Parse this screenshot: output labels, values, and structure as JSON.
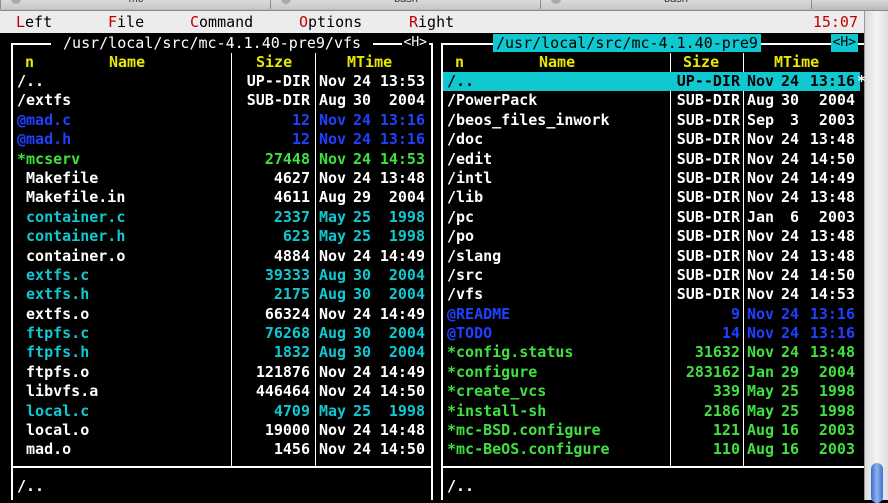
{
  "window_tabs": [
    {
      "title": "mc"
    },
    {
      "title": "bash"
    },
    {
      "title": "bash"
    }
  ],
  "menubar": {
    "items": [
      {
        "hotkey": "L",
        "rest": "eft"
      },
      {
        "hotkey": "F",
        "rest": "ile"
      },
      {
        "hotkey": "C",
        "rest": "ommand"
      },
      {
        "hotkey": "O",
        "rest": "ptions"
      },
      {
        "hotkey": "R",
        "rest": "ight"
      }
    ],
    "clock": "15:07"
  },
  "colors": {
    "dir": "#ffffff",
    "plain": "#ffffff",
    "source": "#10c8d0",
    "exec": "#40e040",
    "link": "#2040ff",
    "header": "#e8e800",
    "selection": "#10c8d0"
  },
  "left_panel": {
    "path": " /usr/local/src/mc-4.1.40-pre9/vfs ",
    "hint": "<H>",
    "columns": {
      "n": "n",
      "name": "Name",
      "size": "Size",
      "mtime": "MTime"
    },
    "status": "/..",
    "rows": [
      {
        "name": "/..",
        "size": "UP--DIR",
        "month": "Nov",
        "day": "24",
        "time": "13:53",
        "kind": "dir"
      },
      {
        "name": "/extfs",
        "size": "SUB-DIR",
        "month": "Aug",
        "day": "30",
        "time": "2004",
        "kind": "dir"
      },
      {
        "name": "@mad.c",
        "size": "12",
        "month": "Nov",
        "day": "24",
        "time": "13:16",
        "kind": "link"
      },
      {
        "name": "@mad.h",
        "size": "12",
        "month": "Nov",
        "day": "24",
        "time": "13:16",
        "kind": "link"
      },
      {
        "name": "*mcserv",
        "size": "27448",
        "month": "Nov",
        "day": "24",
        "time": "14:53",
        "kind": "exec"
      },
      {
        "name": " Makefile",
        "size": "4627",
        "month": "Nov",
        "day": "24",
        "time": "13:48",
        "kind": "plain"
      },
      {
        "name": " Makefile.in",
        "size": "4611",
        "month": "Aug",
        "day": "29",
        "time": "2004",
        "kind": "plain"
      },
      {
        "name": " container.c",
        "size": "2337",
        "month": "May",
        "day": "25",
        "time": "1998",
        "kind": "source"
      },
      {
        "name": " container.h",
        "size": "623",
        "month": "May",
        "day": "25",
        "time": "1998",
        "kind": "source"
      },
      {
        "name": " container.o",
        "size": "4884",
        "month": "Nov",
        "day": "24",
        "time": "14:49",
        "kind": "plain"
      },
      {
        "name": " extfs.c",
        "size": "39333",
        "month": "Aug",
        "day": "30",
        "time": "2004",
        "kind": "source"
      },
      {
        "name": " extfs.h",
        "size": "2175",
        "month": "Aug",
        "day": "30",
        "time": "2004",
        "kind": "source"
      },
      {
        "name": " extfs.o",
        "size": "66324",
        "month": "Nov",
        "day": "24",
        "time": "14:49",
        "kind": "plain"
      },
      {
        "name": " ftpfs.c",
        "size": "76268",
        "month": "Aug",
        "day": "30",
        "time": "2004",
        "kind": "source"
      },
      {
        "name": " ftpfs.h",
        "size": "1832",
        "month": "Aug",
        "day": "30",
        "time": "2004",
        "kind": "source"
      },
      {
        "name": " ftpfs.o",
        "size": "121876",
        "month": "Nov",
        "day": "24",
        "time": "14:49",
        "kind": "plain"
      },
      {
        "name": " libvfs.a",
        "size": "446464",
        "month": "Nov",
        "day": "24",
        "time": "14:50",
        "kind": "plain"
      },
      {
        "name": " local.c",
        "size": "4709",
        "month": "May",
        "day": "25",
        "time": "1998",
        "kind": "source"
      },
      {
        "name": " local.o",
        "size": "19000",
        "month": "Nov",
        "day": "24",
        "time": "14:48",
        "kind": "plain"
      },
      {
        "name": " mad.o",
        "size": "1456",
        "month": "Nov",
        "day": "24",
        "time": "14:50",
        "kind": "plain"
      }
    ]
  },
  "right_panel": {
    "path": "/usr/local/src/mc-4.1.40-pre9",
    "hint": "<H>",
    "columns": {
      "n": "n",
      "name": "Name",
      "size": "Size",
      "mtime": "MTime"
    },
    "status": "/..",
    "selected_index": 0,
    "rows": [
      {
        "name": "/..",
        "size": "UP--DIR",
        "month": "Nov",
        "day": "24",
        "time": "13:16",
        "kind": "dir",
        "mark": "*"
      },
      {
        "name": "/PowerPack",
        "size": "SUB-DIR",
        "month": "Aug",
        "day": "30",
        "time": "2004",
        "kind": "dir"
      },
      {
        "name": "/beos_files_inwork",
        "size": "SUB-DIR",
        "month": "Sep",
        "day": "3",
        "time": "2003",
        "kind": "dir"
      },
      {
        "name": "/doc",
        "size": "SUB-DIR",
        "month": "Nov",
        "day": "24",
        "time": "13:48",
        "kind": "dir"
      },
      {
        "name": "/edit",
        "size": "SUB-DIR",
        "month": "Nov",
        "day": "24",
        "time": "14:50",
        "kind": "dir"
      },
      {
        "name": "/intl",
        "size": "SUB-DIR",
        "month": "Nov",
        "day": "24",
        "time": "14:49",
        "kind": "dir"
      },
      {
        "name": "/lib",
        "size": "SUB-DIR",
        "month": "Nov",
        "day": "24",
        "time": "13:48",
        "kind": "dir"
      },
      {
        "name": "/pc",
        "size": "SUB-DIR",
        "month": "Jan",
        "day": "6",
        "time": "2003",
        "kind": "dir"
      },
      {
        "name": "/po",
        "size": "SUB-DIR",
        "month": "Nov",
        "day": "24",
        "time": "13:48",
        "kind": "dir"
      },
      {
        "name": "/slang",
        "size": "SUB-DIR",
        "month": "Nov",
        "day": "24",
        "time": "13:48",
        "kind": "dir"
      },
      {
        "name": "/src",
        "size": "SUB-DIR",
        "month": "Nov",
        "day": "24",
        "time": "14:50",
        "kind": "dir"
      },
      {
        "name": "/vfs",
        "size": "SUB-DIR",
        "month": "Nov",
        "day": "24",
        "time": "14:53",
        "kind": "dir"
      },
      {
        "name": "@README",
        "size": "9",
        "month": "Nov",
        "day": "24",
        "time": "13:16",
        "kind": "link"
      },
      {
        "name": "@TODO",
        "size": "14",
        "month": "Nov",
        "day": "24",
        "time": "13:16",
        "kind": "link"
      },
      {
        "name": "*config.status",
        "size": "31632",
        "month": "Nov",
        "day": "24",
        "time": "13:48",
        "kind": "exec"
      },
      {
        "name": "*configure",
        "size": "283162",
        "month": "Jan",
        "day": "29",
        "time": "2004",
        "kind": "exec"
      },
      {
        "name": "*create_vcs",
        "size": "339",
        "month": "May",
        "day": "25",
        "time": "1998",
        "kind": "exec"
      },
      {
        "name": "*install-sh",
        "size": "2186",
        "month": "May",
        "day": "25",
        "time": "1998",
        "kind": "exec"
      },
      {
        "name": "*mc-BSD.configure",
        "size": "121",
        "month": "Aug",
        "day": "16",
        "time": "2003",
        "kind": "exec"
      },
      {
        "name": "*mc-BeOS.configure",
        "size": "110",
        "month": "Aug",
        "day": "16",
        "time": "2003",
        "kind": "exec"
      }
    ]
  }
}
